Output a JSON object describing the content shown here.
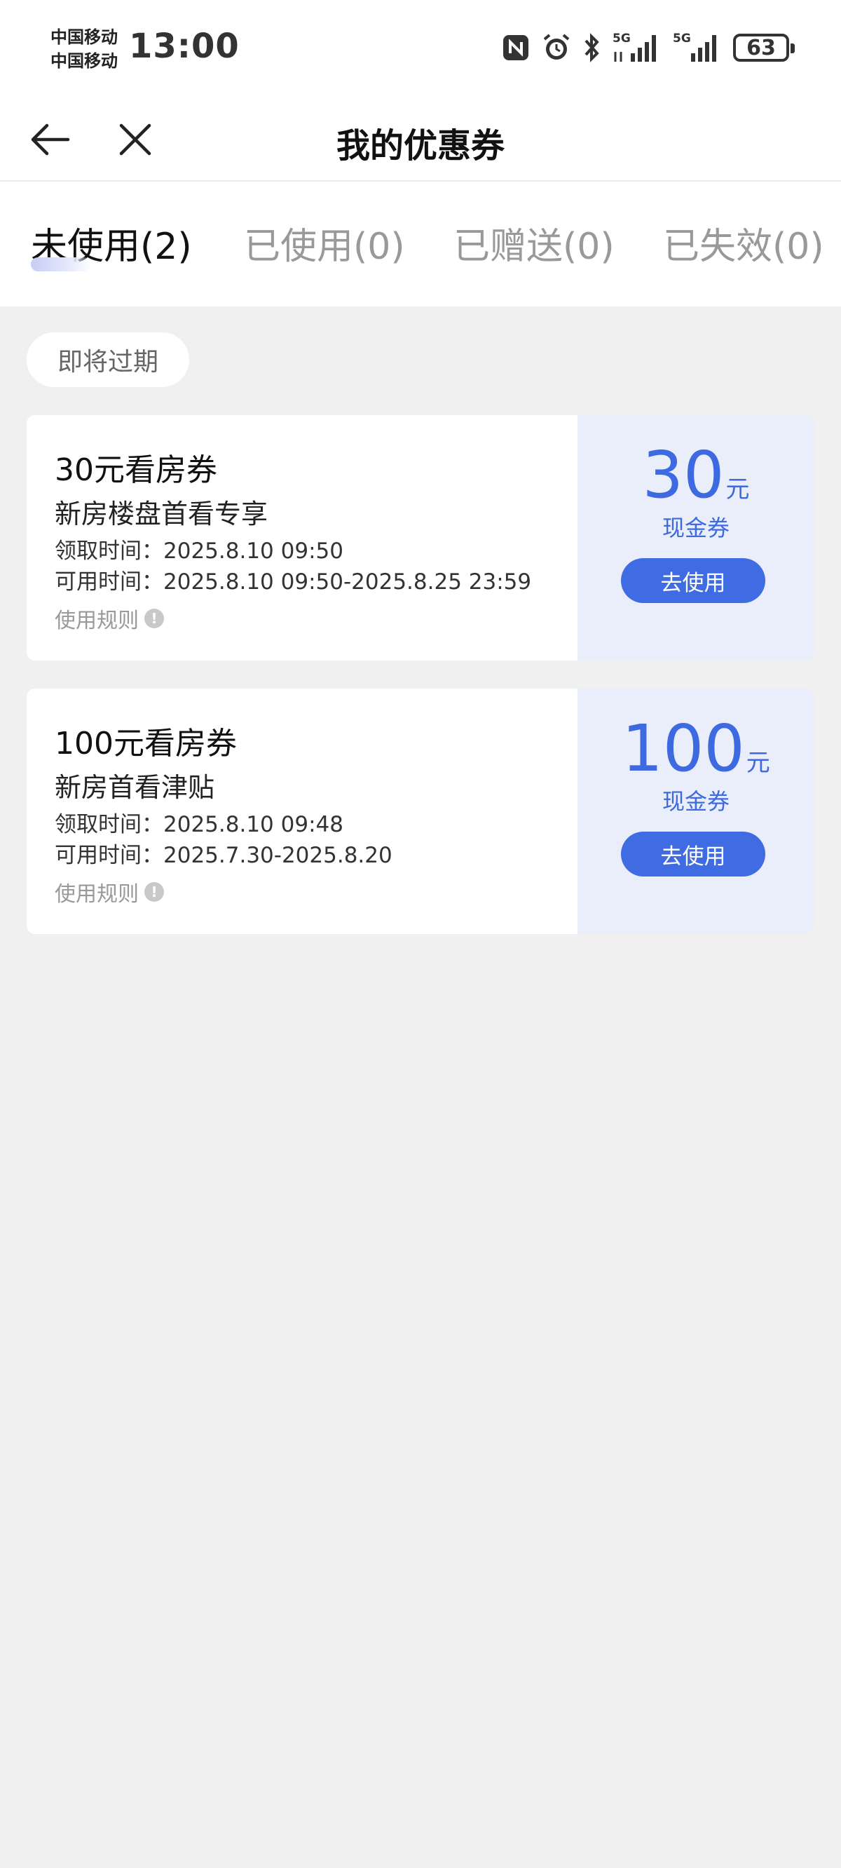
{
  "status_bar": {
    "carrier_1": "中国移动",
    "carrier_2": "中国移动",
    "time": "13:00",
    "battery": "63",
    "icons": [
      "nfc-icon",
      "alarm-icon",
      "bluetooth-icon",
      "signal-5g-icon",
      "signal-5g-icon",
      "battery-icon"
    ]
  },
  "nav": {
    "title": "我的优惠券",
    "back_icon": "back-arrow-icon",
    "close_icon": "close-icon"
  },
  "tabs": [
    {
      "label": "未使用(2)",
      "active": true
    },
    {
      "label": "已使用(0)",
      "active": false
    },
    {
      "label": "已赠送(0)",
      "active": false
    },
    {
      "label": "已失效(0)",
      "active": false
    }
  ],
  "filter_chip": "即将过期",
  "coupons": [
    {
      "title": "30元看房券",
      "subtitle": "新房楼盘首看专享",
      "received": "领取时间：2025.8.10 09:50",
      "valid": "可用时间：2025.8.10 09:50-2025.8.25 23:59",
      "rules": "使用规则",
      "amount": "30",
      "unit": "元",
      "type": "现金券",
      "button": "去使用"
    },
    {
      "title": "100元看房券",
      "subtitle": "新房首看津贴",
      "received": "领取时间：2025.8.10 09:48",
      "valid": "可用时间：2025.7.30-2025.8.20",
      "rules": "使用规则",
      "amount": "100",
      "unit": "元",
      "type": "现金券",
      "button": "去使用"
    }
  ],
  "colors": {
    "accent": "#3f6ce3",
    "coupon_right_bg": "#eaeefb",
    "page_bg": "#f0f0f0"
  }
}
